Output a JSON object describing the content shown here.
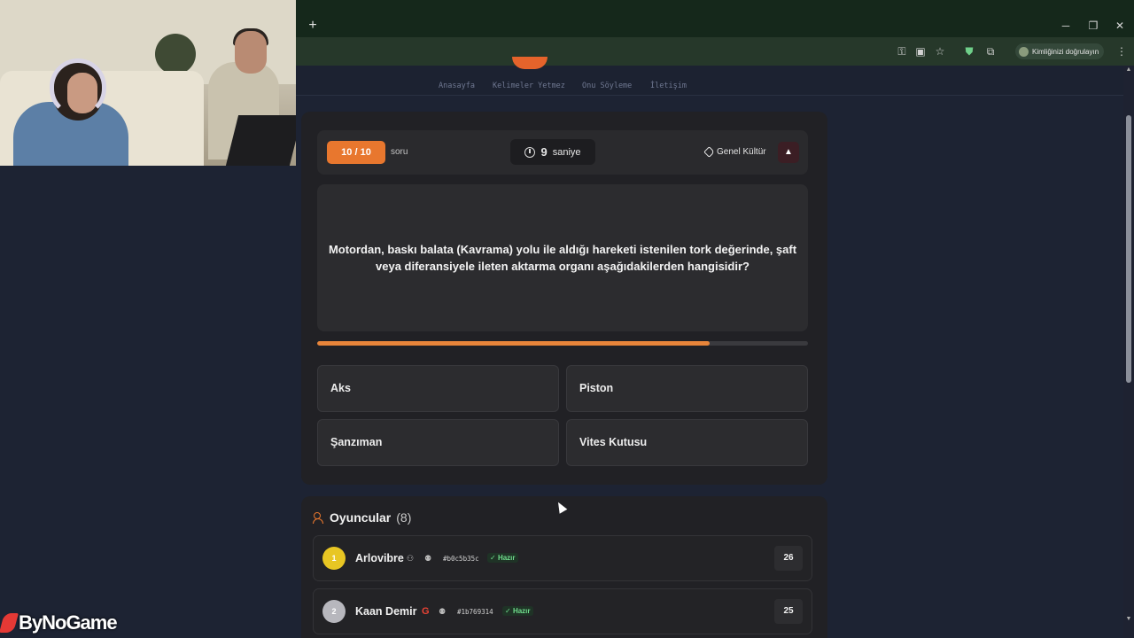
{
  "browser": {
    "new_tab": "+",
    "win_minimize": "─",
    "win_restore": "❐",
    "win_close": "✕",
    "profile_label": "Kimliğinizi doğrulayın"
  },
  "site": {
    "nav": [
      "Anasayfa",
      "Kelimeler Yetmez",
      "Onu Söyleme",
      "İletişim"
    ]
  },
  "game": {
    "counter": "10 / 10",
    "counter_suffix": "soru",
    "timer_value": "9",
    "timer_unit": "saniye",
    "category": "Genel Kültür",
    "report_icon": "▲",
    "question": "Motordan, baskı balata (Kavrama) yolu ile aldığı hareketi istenilen tork değerinde, şaft veya diferansiyele ileten aktarma organı aşağıdakilerden hangisidir?",
    "progress_percent": 80,
    "answers": [
      "Aks",
      "Piston",
      "Şanzıman",
      "Vites Kutusu"
    ]
  },
  "players": {
    "title": "Oyuncular",
    "count": "(8)",
    "rows": [
      {
        "rank": "1",
        "name": "Arlovibre",
        "hash": "#b0c5b35c",
        "status": "Hazır",
        "score": "26",
        "rank_color": "#e8c623"
      },
      {
        "rank": "2",
        "name": "Kaan Demir",
        "hash": "#1b769314",
        "status": "Hazır",
        "score": "25",
        "rank_color": "#b7b7bd"
      }
    ]
  },
  "watermark": {
    "text": "ByNoGame"
  },
  "colors": {
    "accent": "#e8772e",
    "ready": "#6fdc8c",
    "background": "#1d2333"
  }
}
